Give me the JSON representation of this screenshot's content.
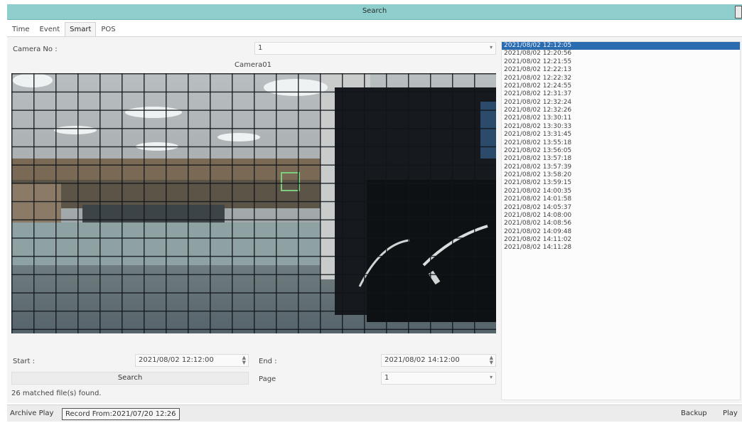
{
  "window": {
    "title": "Search"
  },
  "tabs": [
    {
      "label": "Time",
      "active": false
    },
    {
      "label": "Event",
      "active": false
    },
    {
      "label": "Smart",
      "active": true
    },
    {
      "label": "POS",
      "active": false
    }
  ],
  "camera": {
    "label": "Camera No :",
    "selected": "1",
    "name": "Camera01"
  },
  "results": [
    "2021/08/02  12:12:05",
    "2021/08/02  12:20:56",
    "2021/08/02  12:21:55",
    "2021/08/02  12:22:13",
    "2021/08/02  12:22:32",
    "2021/08/02  12:24:55",
    "2021/08/02  12:31:37",
    "2021/08/02  12:32:24",
    "2021/08/02  12:32:26",
    "2021/08/02  13:30:11",
    "2021/08/02  13:30:33",
    "2021/08/02  13:31:45",
    "2021/08/02  13:55:18",
    "2021/08/02  13:56:05",
    "2021/08/02  13:57:18",
    "2021/08/02  13:57:39",
    "2021/08/02  13:58:20",
    "2021/08/02  13:59:15",
    "2021/08/02  14:00:35",
    "2021/08/02  14:01:58",
    "2021/08/02  14:05:37",
    "2021/08/02  14:08:00",
    "2021/08/02  14:08:56",
    "2021/08/02  14:09:48",
    "2021/08/02  14:11:02",
    "2021/08/02  14:11:28"
  ],
  "selected_index": 0,
  "search": {
    "start_label": "Start :",
    "start_value": "2021/08/02 12:12:00",
    "end_label": "End :",
    "end_value": "2021/08/02 14:12:00",
    "search_button": "Search",
    "page_label": "Page",
    "page_value": "1",
    "status": "26 matched file(s) found."
  },
  "bottom": {
    "archive_play": "Archive Play",
    "record_from": "Record From:2021/07/20 12:26",
    "backup": "Backup",
    "play": "Play"
  },
  "colors": {
    "titlebar": "#8ecfcd",
    "selection": "#2b6cb0"
  }
}
